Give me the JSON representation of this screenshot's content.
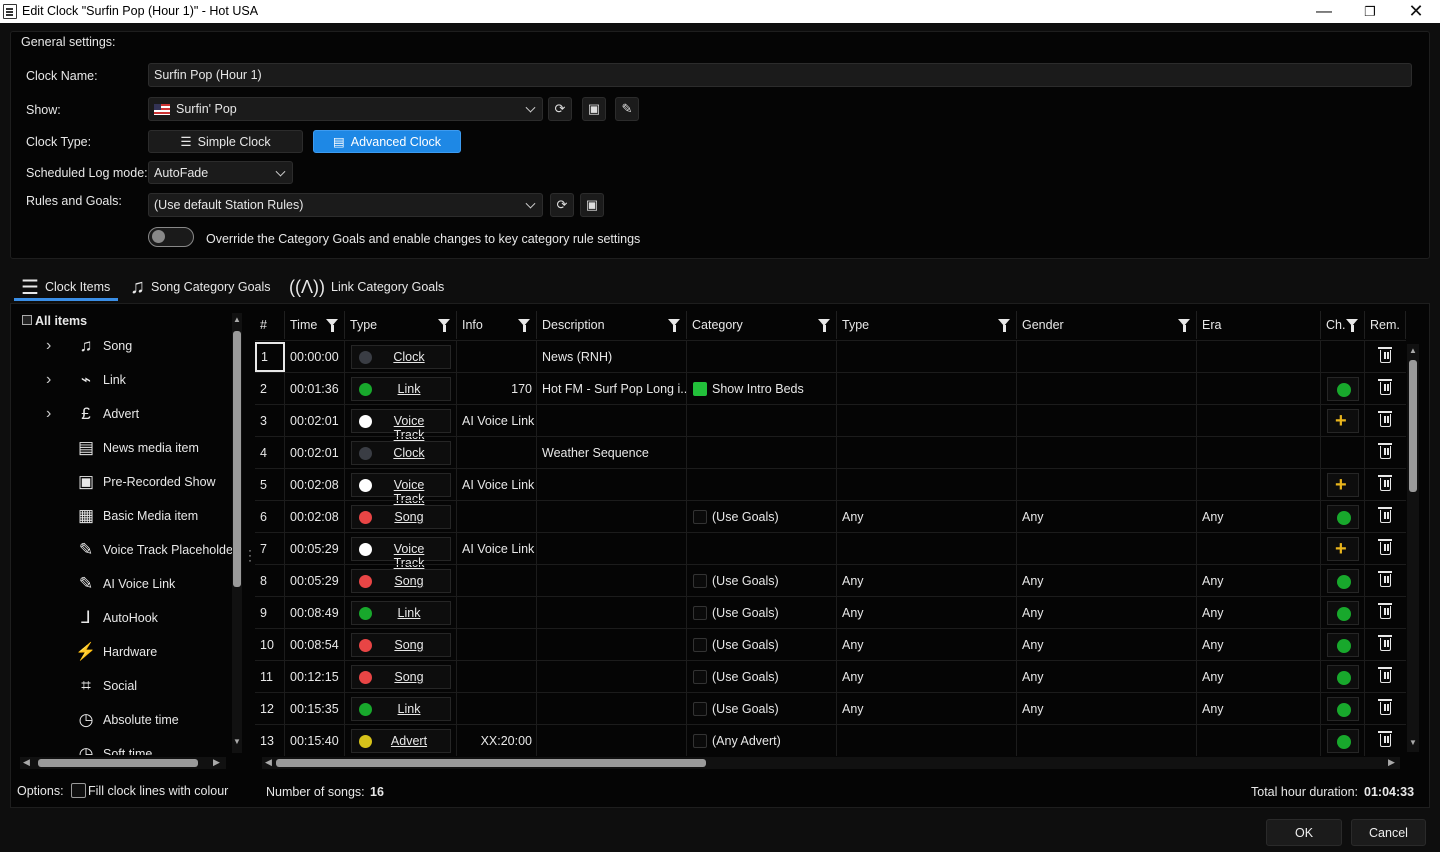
{
  "window": {
    "title": "Edit Clock \"Surfin Pop (Hour 1)\" - Hot USA"
  },
  "general": {
    "section_title": "General settings:",
    "clock_name_label": "Clock Name:",
    "clock_name_value": "Surfin Pop (Hour 1)",
    "show_label": "Show:",
    "show_value": "Surfin' Pop",
    "clock_type_label": "Clock Type:",
    "simple_clock": "Simple Clock",
    "advanced_clock": "Advanced Clock",
    "log_mode_label": "Scheduled Log mode:",
    "log_mode_value": "AutoFade",
    "rules_label": "Rules and Goals:",
    "rules_value": "(Use default Station Rules)",
    "override_text": "Override the Category Goals and enable changes to key category rule settings",
    "override_on": false
  },
  "tabs": [
    {
      "label": "Clock Items",
      "icon": "list-icon",
      "active": true
    },
    {
      "label": "Song Category Goals",
      "icon": "music-note-icon",
      "active": false
    },
    {
      "label": "Link Category Goals",
      "icon": "antenna-icon",
      "active": false
    }
  ],
  "tree": {
    "root": "All items",
    "items": [
      {
        "label": "Song",
        "icon": "music-note-icon",
        "glyph": "♫",
        "expandable": true
      },
      {
        "label": "Link",
        "icon": "antenna-icon",
        "glyph": "⌁",
        "expandable": true
      },
      {
        "label": "Advert",
        "icon": "pound-icon",
        "glyph": "£",
        "expandable": true
      },
      {
        "label": "News media item",
        "icon": "newspaper-icon",
        "glyph": "▤",
        "expandable": false
      },
      {
        "label": "Pre-Recorded Show",
        "icon": "tape-icon",
        "glyph": "▣",
        "expandable": false
      },
      {
        "label": "Basic Media item",
        "icon": "media-icon",
        "glyph": "▦",
        "expandable": false
      },
      {
        "label": "Voice Track Placeholder",
        "icon": "microphone-icon",
        "glyph": "✎",
        "expandable": false
      },
      {
        "label": "AI Voice Link",
        "icon": "ai-microphone-icon",
        "glyph": "✎",
        "expandable": false
      },
      {
        "label": "AutoHook",
        "icon": "hook-icon",
        "glyph": "⅃",
        "expandable": false
      },
      {
        "label": "Hardware",
        "icon": "plug-icon",
        "glyph": "⚡",
        "expandable": false
      },
      {
        "label": "Social",
        "icon": "social-icon",
        "glyph": "⌗",
        "expandable": false
      },
      {
        "label": "Absolute time",
        "icon": "clock-icon",
        "glyph": "◷",
        "expandable": false
      },
      {
        "label": "Soft time",
        "icon": "soft-clock-icon",
        "glyph": "◷",
        "expandable": false
      }
    ]
  },
  "grid": {
    "columns": [
      "#",
      "Time",
      "Type",
      "Info",
      "Description",
      "Category",
      "Type",
      "Gender",
      "Era",
      "Ch.",
      "Rem."
    ],
    "rows": [
      {
        "n": "1",
        "time": "00:00:00",
        "dot": "#3a3d44",
        "type": "Clock",
        "info": "",
        "desc": "News (RNH)",
        "cat": "",
        "catbox": "none",
        "type2": "",
        "gender": "",
        "era": "",
        "ch": "none"
      },
      {
        "n": "2",
        "time": "00:01:36",
        "dot": "#18a82c",
        "type": "Link",
        "info": "170",
        "desc": "Hot FM - Surf Pop Long i...",
        "cat": "Show Intro Beds",
        "catbox": "green",
        "type2": "",
        "gender": "",
        "era": "",
        "ch": "green"
      },
      {
        "n": "3",
        "time": "00:02:01",
        "dot": "#ffffff",
        "type": "Voice Track",
        "info": "AI Voice Link",
        "desc": "",
        "cat": "",
        "catbox": "none",
        "type2": "",
        "gender": "",
        "era": "",
        "ch": "plus"
      },
      {
        "n": "4",
        "time": "00:02:01",
        "dot": "#3a3d44",
        "type": "Clock",
        "info": "",
        "desc": "Weather Sequence",
        "cat": "",
        "catbox": "none",
        "type2": "",
        "gender": "",
        "era": "",
        "ch": "none"
      },
      {
        "n": "5",
        "time": "00:02:08",
        "dot": "#ffffff",
        "type": "Voice Track",
        "info": "AI Voice Link",
        "desc": "",
        "cat": "",
        "catbox": "none",
        "type2": "",
        "gender": "",
        "era": "",
        "ch": "plus"
      },
      {
        "n": "6",
        "time": "00:02:08",
        "dot": "#e84545",
        "type": "Song",
        "info": "",
        "desc": "",
        "cat": "(Use Goals)",
        "catbox": "empty",
        "type2": "Any",
        "gender": "Any",
        "era": "Any",
        "ch": "green"
      },
      {
        "n": "7",
        "time": "00:05:29",
        "dot": "#ffffff",
        "type": "Voice Track",
        "info": "AI Voice Link",
        "desc": "",
        "cat": "",
        "catbox": "none",
        "type2": "",
        "gender": "",
        "era": "",
        "ch": "plus"
      },
      {
        "n": "8",
        "time": "00:05:29",
        "dot": "#e84545",
        "type": "Song",
        "info": "",
        "desc": "",
        "cat": "(Use Goals)",
        "catbox": "empty",
        "type2": "Any",
        "gender": "Any",
        "era": "Any",
        "ch": "green"
      },
      {
        "n": "9",
        "time": "00:08:49",
        "dot": "#18a82c",
        "type": "Link",
        "info": "",
        "desc": "",
        "cat": "(Use Goals)",
        "catbox": "empty",
        "type2": "Any",
        "gender": "Any",
        "era": "Any",
        "ch": "green"
      },
      {
        "n": "10",
        "time": "00:08:54",
        "dot": "#e84545",
        "type": "Song",
        "info": "",
        "desc": "",
        "cat": "(Use Goals)",
        "catbox": "empty",
        "type2": "Any",
        "gender": "Any",
        "era": "Any",
        "ch": "green"
      },
      {
        "n": "11",
        "time": "00:12:15",
        "dot": "#e84545",
        "type": "Song",
        "info": "",
        "desc": "",
        "cat": "(Use Goals)",
        "catbox": "empty",
        "type2": "Any",
        "gender": "Any",
        "era": "Any",
        "ch": "green"
      },
      {
        "n": "12",
        "time": "00:15:35",
        "dot": "#18a82c",
        "type": "Link",
        "info": "",
        "desc": "",
        "cat": "(Use Goals)",
        "catbox": "empty",
        "type2": "Any",
        "gender": "Any",
        "era": "Any",
        "ch": "green"
      },
      {
        "n": "13",
        "time": "00:15:40",
        "dot": "#d6c21a",
        "type": "Advert",
        "info": "XX:20:00",
        "desc": "",
        "cat": "(Any Advert)",
        "catbox": "empty",
        "type2": "",
        "gender": "",
        "era": "",
        "ch": "green"
      }
    ]
  },
  "footer": {
    "options_label": "Options:",
    "fill_lines_label": "Fill clock lines with colour",
    "num_songs_label": "Number of songs:",
    "num_songs_value": "16",
    "total_label": "Total hour duration:",
    "total_value": "01:04:33",
    "ok": "OK",
    "cancel": "Cancel"
  }
}
